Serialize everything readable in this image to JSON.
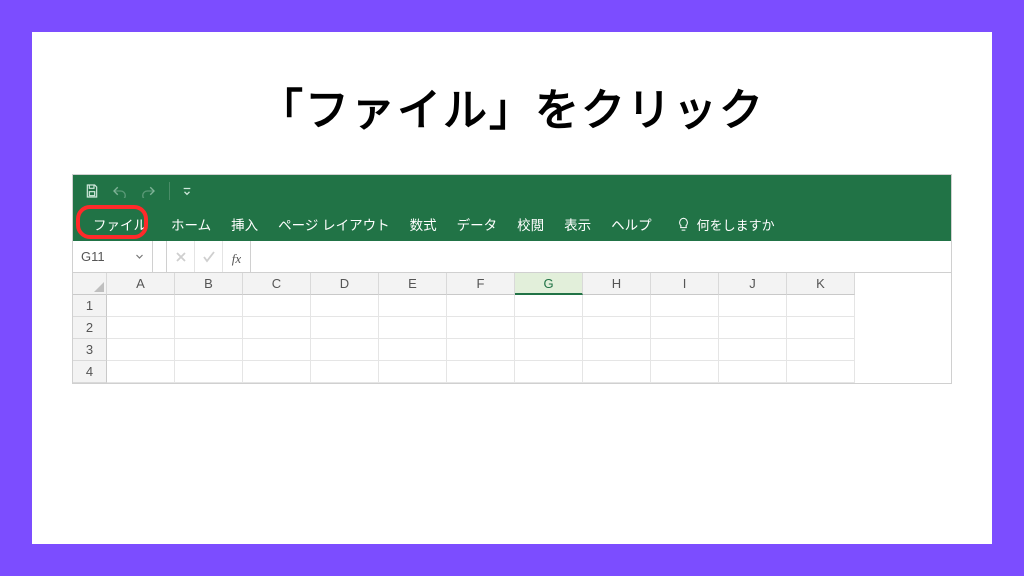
{
  "headline": "「ファイル」をクリック",
  "tabs": {
    "file": "ファイル",
    "home": "ホーム",
    "insert": "挿入",
    "pageLayout": "ページ レイアウト",
    "formulas": "数式",
    "data": "データ",
    "review": "校閲",
    "view": "表示",
    "help": "ヘルプ",
    "tellMe": "何をしますか"
  },
  "nameBox": "G11",
  "fxLabel": "fx",
  "columns": [
    "A",
    "B",
    "C",
    "D",
    "E",
    "F",
    "G",
    "H",
    "I",
    "J",
    "K"
  ],
  "rows": [
    "1",
    "2",
    "3",
    "4"
  ],
  "activeColumn": "G"
}
